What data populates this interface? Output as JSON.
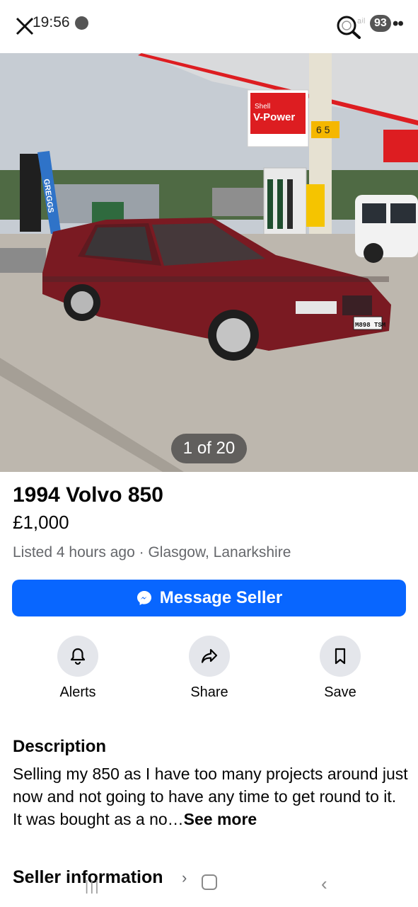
{
  "status_bar": {
    "time": "19:56",
    "battery": "93",
    "signal": "ᵃⁱˡ",
    "more": "••"
  },
  "photo": {
    "counter": "1 of 20",
    "signage": {
      "shell_brand": "Shell",
      "shell_product": "V-Power",
      "pump_numbers": "6 5",
      "bakery": "GREGGS",
      "plate": "M898 TSM"
    }
  },
  "listing": {
    "title": "1994 Volvo 850",
    "price": "£1,000",
    "meta": "Listed 4 hours ago · Glasgow, Lanarkshire"
  },
  "message_button": {
    "label": "Message Seller"
  },
  "actions": [
    {
      "label": "Alerts",
      "icon": "bell-icon"
    },
    {
      "label": "Share",
      "icon": "share-arrow-icon"
    },
    {
      "label": "Save",
      "icon": "bookmark-icon"
    }
  ],
  "description": {
    "heading": "Description",
    "text": "Selling my 850 as I have too many projects around just now and not going to have any time to get round to it. It was bought as a no…",
    "see_more": "See more"
  },
  "seller": {
    "heading": "Seller information",
    "chevron": "›"
  },
  "nav_bar": {
    "recent": "|||",
    "back": "‹"
  },
  "colors": {
    "accent": "#0866ff",
    "car": "#7a1a22",
    "shell_red": "#dd1d21",
    "icon_circle": "#e4e6eb"
  }
}
